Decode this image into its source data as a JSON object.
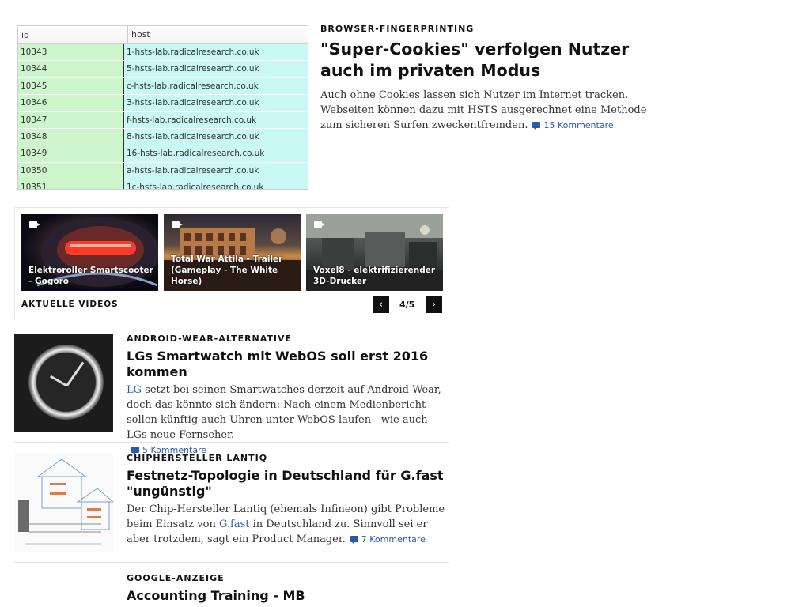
{
  "db_table": {
    "headers": [
      "id",
      "host"
    ],
    "rows": [
      [
        "10343",
        "1-hsts-lab.radicalresearch.co.uk"
      ],
      [
        "10344",
        "5-hsts-lab.radicalresearch.co.uk"
      ],
      [
        "10345",
        "c-hsts-lab.radicalresearch.co.uk"
      ],
      [
        "10346",
        "3-hsts-lab.radicalresearch.co.uk"
      ],
      [
        "10347",
        "f-hsts-lab.radicalresearch.co.uk"
      ],
      [
        "10348",
        "8-hsts-lab.radicalresearch.co.uk"
      ],
      [
        "10349",
        "16-hsts-lab.radicalresearch.co.uk"
      ],
      [
        "10350",
        "a-hsts-lab.radicalresearch.co.uk"
      ],
      [
        "10351",
        "1c-hsts-lab.radicalresearch.co.uk"
      ]
    ]
  },
  "top_story": {
    "kicker": "BROWSER-FINGERPRINTING",
    "title": "\"Super-Cookies\" verfolgen Nutzer auch im privaten Modus",
    "teaser": "Auch ohne Cookies lassen sich Nutzer im Internet tracken. Webseiten können dazu mit HSTS ausgerechnet eine Methode zum sicheren Surfen zweckentfremden.",
    "comments": "15 Kommentare"
  },
  "videos": {
    "items": [
      {
        "label": "Elektroroller Smartscooter - Gogoro",
        "icon": "video-camera-icon"
      },
      {
        "label": "Total War Attila - Trailer (Gameplay - The White Horse)",
        "icon": "video-camera-icon"
      },
      {
        "label": "Voxel8 - elektrifizierender 3D-Drucker",
        "icon": "video-camera-icon"
      }
    ],
    "heading": "AKTUELLE VIDEOS",
    "pager": "4/5",
    "prev": "‹",
    "next": "›"
  },
  "articles": [
    {
      "kicker": "ANDROID-WEAR-ALTERNATIVE",
      "title": "LGs Smartwatch mit WebOS soll erst 2016 kommen",
      "teaser_link": "LG",
      "teaser": " setzt bei seinen Smartwatches derzeit auf Android Wear, doch das könnte sich ändern: Nach einem Medienbericht sollen künftig auch Uhren unter WebOS laufen - wie auch LGs neue Fernseher.",
      "comments": "5 Kommentare"
    },
    {
      "kicker": "CHIPHERSTELLER LANTIQ",
      "title": "Festnetz-Topologie in Deutschland für G.fast \"ungünstig\"",
      "teaser_a": "Der Chip-Hersteller Lantiq (ehemals Infineon) gibt Probleme beim Einsatz von ",
      "teaser_link": "G.fast",
      "teaser_b": " in Deutschland zu. Sinnvoll sei er aber trotzdem, sagt ein Product Manager.",
      "comments": "7 Kommentare"
    },
    {
      "kicker": "GOOGLE-ANZEIGE",
      "title": "Accounting Training - MB"
    }
  ],
  "colors": {
    "link": "#2a5ba8",
    "id_cell": "#ccf5cc",
    "host_cell": "#c9f7f4"
  }
}
